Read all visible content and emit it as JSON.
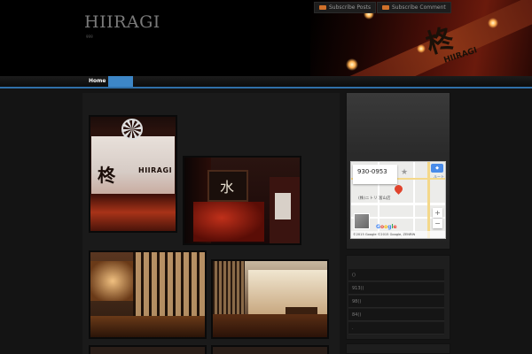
{
  "header": {
    "site_title": "HIIRAGI",
    "site_description": "ggg",
    "subscribe_posts": "Subscribe Posts",
    "subscribe_comment": "Subscribe Comment",
    "banner_logo": "柊",
    "banner_logo_sub": "HIIRAGI"
  },
  "nav": {
    "items": [
      {
        "label": "Home"
      }
    ],
    "accent_color": "#3d86c6"
  },
  "photos": {
    "signboard_kanji": "柊",
    "signboard_latin": "HIIRAGI"
  },
  "map": {
    "postal_code": "930-0953",
    "place_label": "(株)ニトリ 富山店",
    "route_label": "ルート",
    "zoom_in": "+",
    "zoom_out": "−",
    "attribution": "©2015 Google  ©2015 Google, ZENRIN",
    "logo": "Google"
  },
  "sidebar_list": {
    "items": [
      "()",
      "913()",
      "98()",
      "84()",
      "."
    ]
  }
}
